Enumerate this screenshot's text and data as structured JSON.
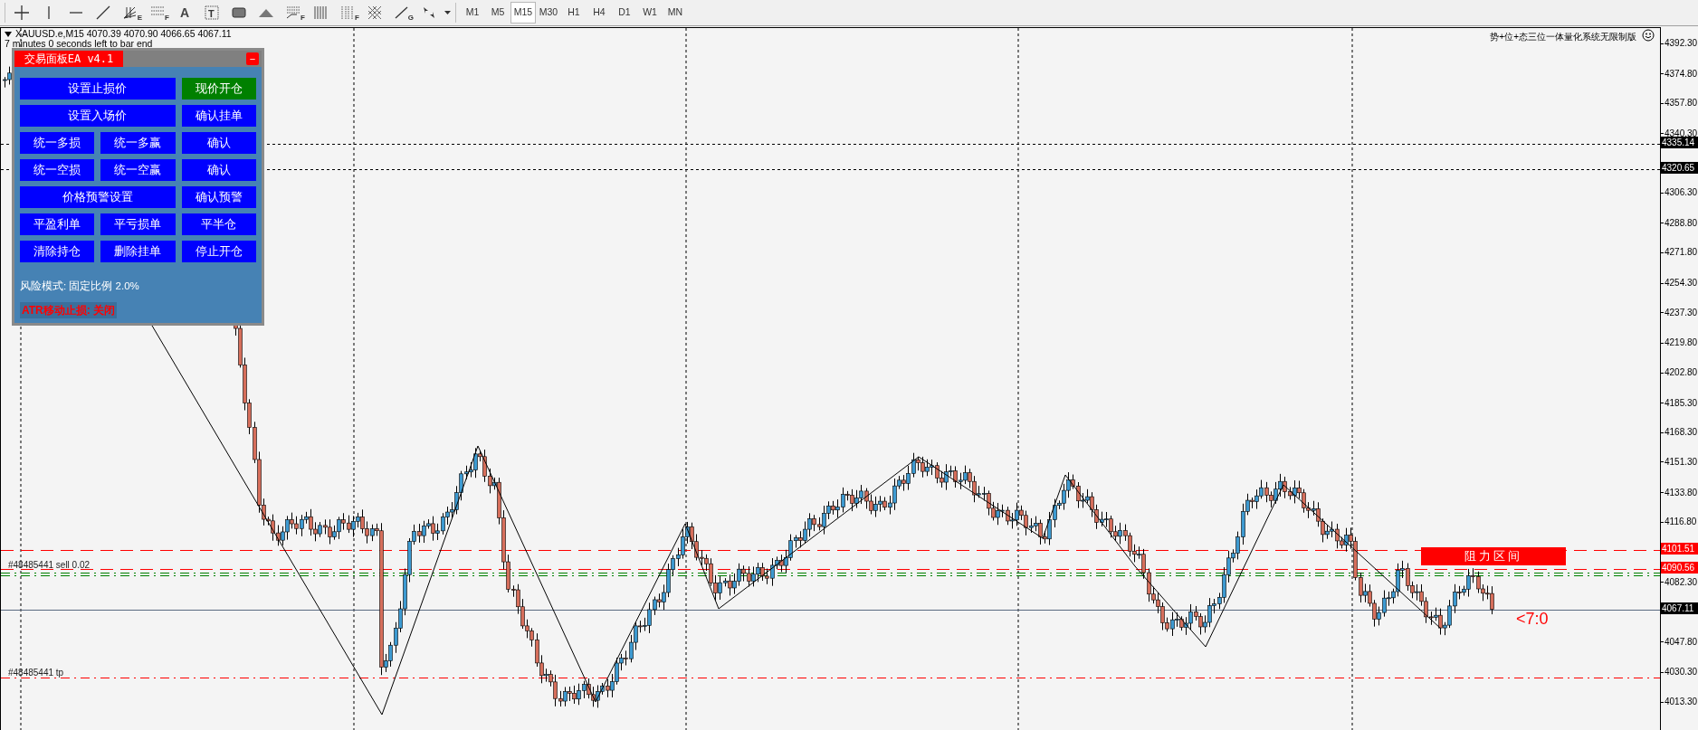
{
  "toolbar": {
    "tools": [
      {
        "kind": "crosshair"
      },
      {
        "kind": "vline"
      },
      {
        "kind": "hline"
      },
      {
        "kind": "trendline"
      },
      {
        "kind": "fan",
        "label": "E"
      },
      {
        "kind": "channel",
        "label": "F"
      },
      {
        "kind": "text",
        "label": "A"
      },
      {
        "kind": "textlabel",
        "label": "T"
      },
      {
        "kind": "rectangle"
      },
      {
        "kind": "triangle"
      },
      {
        "kind": "fibo",
        "label": "F"
      },
      {
        "kind": "cycles"
      },
      {
        "kind": "timezones",
        "label": "F"
      },
      {
        "kind": "grid"
      },
      {
        "kind": "gannline",
        "label": "G"
      },
      {
        "kind": "arrows"
      }
    ],
    "timeframes": [
      {
        "label": "M1",
        "selected": false
      },
      {
        "label": "M5",
        "selected": false
      },
      {
        "label": "M15",
        "selected": true
      },
      {
        "label": "M30",
        "selected": false
      },
      {
        "label": "H1",
        "selected": false
      },
      {
        "label": "H4",
        "selected": false
      },
      {
        "label": "D1",
        "selected": false
      },
      {
        "label": "W1",
        "selected": false
      },
      {
        "label": "MN",
        "selected": false
      }
    ]
  },
  "chart": {
    "symbol_line": "XAUUSD.e,M15  4070.39 4070.90 4066.65 4067.11",
    "countdown": "7 minutes 0 seconds left to bar end",
    "system_name": "势+位+态三位一体量化系统无限制版",
    "order_labels": [
      "#48485441 sell 0.02",
      "#48485441 tp"
    ],
    "zone_label": "阻力区间",
    "signal_text": "<7:0",
    "price_axis": {
      "ticks": [
        "4392.30",
        "4374.80",
        "4357.80",
        "4340.30",
        "4306.30",
        "4288.80",
        "4271.80",
        "4254.30",
        "4237.30",
        "4219.80",
        "4202.80",
        "4185.30",
        "4168.30",
        "4151.30",
        "4133.80",
        "4116.80",
        "4082.30",
        "4047.80",
        "4030.30",
        "4013.30"
      ],
      "markers": [
        {
          "value": "4335.14",
          "color": "#000000"
        },
        {
          "value": "4320.65",
          "color": "#000000"
        },
        {
          "value": "4101.51",
          "color": "#ff0000"
        },
        {
          "value": "4090.56",
          "color": "#ff0000"
        },
        {
          "value": "4067.11",
          "color": "#000000"
        }
      ]
    }
  },
  "panel": {
    "title": "交易面板EA v4.1",
    "close": "−",
    "rows": [
      [
        {
          "label": "设置止损价",
          "kind": "blue"
        },
        {
          "label": "现价开仓",
          "kind": "green"
        }
      ],
      [
        {
          "label": "设置入场价",
          "kind": "blue"
        },
        {
          "label": "确认挂单",
          "kind": "blue"
        }
      ],
      [
        {
          "label": "统一多损",
          "kind": "blue"
        },
        {
          "label": "统一多赢",
          "kind": "blue"
        },
        {
          "label": "确认",
          "kind": "blue"
        }
      ],
      [
        {
          "label": "统一空损",
          "kind": "blue"
        },
        {
          "label": "统一空赢",
          "kind": "blue"
        },
        {
          "label": "确认",
          "kind": "blue"
        }
      ],
      [
        {
          "label": "价格预警设置",
          "kind": "blue"
        },
        {
          "label": "确认预警",
          "kind": "blue"
        }
      ],
      [
        {
          "label": "平盈利单",
          "kind": "blue"
        },
        {
          "label": "平亏损单",
          "kind": "blue"
        },
        {
          "label": "平半仓",
          "kind": "blue"
        }
      ],
      [
        {
          "label": "清除持仓",
          "kind": "blue"
        },
        {
          "label": "删除挂单",
          "kind": "blue"
        },
        {
          "label": "停止开仓",
          "kind": "blue"
        }
      ]
    ],
    "risk_mode": "风险模式: 固定比例 2.0%",
    "atr_status": "ATR移动止损: 关闭"
  }
}
